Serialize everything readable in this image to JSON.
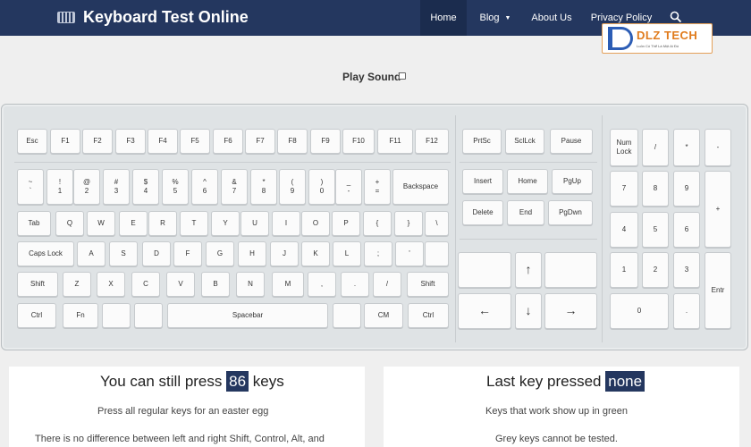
{
  "header": {
    "title": "Keyboard Test Online",
    "nav": [
      "Home",
      "Blog",
      "About Us",
      "Privacy Policy"
    ]
  },
  "logo": {
    "text": "DLZ TECH",
    "tagline": "Luôn Có Thể Là Một Ai Đó"
  },
  "sound": {
    "label": "Play Sound"
  },
  "keyboard": {
    "main": [
      {
        "l": "Esc"
      },
      {
        "l": "F1"
      },
      {
        "l": "F2"
      },
      {
        "l": "F3"
      },
      {
        "l": "F4"
      },
      {
        "l": "F5"
      },
      {
        "l": "F6"
      },
      {
        "l": "F7"
      },
      {
        "l": "F8"
      },
      {
        "l": "F9"
      },
      {
        "l": "F10"
      },
      {
        "l": "F11"
      },
      {
        "l": "F12"
      },
      {
        "t": "~",
        "b": "`"
      },
      {
        "t": "!",
        "b": "1"
      },
      {
        "t": "@",
        "b": "2"
      },
      {
        "t": "#",
        "b": "3"
      },
      {
        "t": "$",
        "b": "4"
      },
      {
        "t": "%",
        "b": "5"
      },
      {
        "t": "^",
        "b": "6"
      },
      {
        "t": "&",
        "b": "7"
      },
      {
        "t": "*",
        "b": "8"
      },
      {
        "t": "(",
        "b": "9"
      },
      {
        "t": ")",
        "b": "0"
      },
      {
        "t": "_",
        "b": "-"
      },
      {
        "t": "+",
        "b": "="
      },
      {
        "l": "Backspace"
      },
      {
        "l": "Tab"
      },
      {
        "l": "Q"
      },
      {
        "l": "W"
      },
      {
        "l": "E"
      },
      {
        "l": "R"
      },
      {
        "l": "T"
      },
      {
        "l": "Y"
      },
      {
        "l": "U"
      },
      {
        "l": "I"
      },
      {
        "l": "O"
      },
      {
        "l": "P"
      },
      {
        "l": "{"
      },
      {
        "l": "}"
      },
      {
        "l": "\\"
      },
      {
        "l": "Caps Lock"
      },
      {
        "l": "A"
      },
      {
        "l": "S"
      },
      {
        "l": "D"
      },
      {
        "l": "F"
      },
      {
        "l": "G"
      },
      {
        "l": "H"
      },
      {
        "l": "J"
      },
      {
        "l": "K"
      },
      {
        "l": "L"
      },
      {
        "l": ";"
      },
      {
        "l": "'"
      },
      {
        "l": ""
      },
      {
        "l": "Shift"
      },
      {
        "l": "Z"
      },
      {
        "l": "X"
      },
      {
        "l": "C"
      },
      {
        "l": "V"
      },
      {
        "l": "B"
      },
      {
        "l": "N"
      },
      {
        "l": "M"
      },
      {
        "l": ","
      },
      {
        "l": "."
      },
      {
        "l": "/"
      },
      {
        "l": "Shift"
      },
      {
        "l": "Ctrl"
      },
      {
        "l": "Fn"
      },
      {
        "l": ""
      },
      {
        "l": ""
      },
      {
        "l": "Spacebar"
      },
      {
        "l": ""
      },
      {
        "l": "CM"
      },
      {
        "l": "Ctrl"
      }
    ],
    "nav": [
      {
        "l": "PrtSc"
      },
      {
        "l": "SclLck"
      },
      {
        "l": "Pause"
      },
      {
        "l": "Insert"
      },
      {
        "l": "Home"
      },
      {
        "l": "PgUp"
      },
      {
        "l": "Delete"
      },
      {
        "l": "End"
      },
      {
        "l": "PgDwn"
      },
      {
        "l": ""
      },
      {
        "l": "↑"
      },
      {
        "l": ""
      },
      {
        "l": "←"
      },
      {
        "l": "↓"
      },
      {
        "l": "→"
      }
    ],
    "numpad": [
      {
        "t": "Num",
        "b": "Lock"
      },
      {
        "l": "/"
      },
      {
        "l": "*"
      },
      {
        "l": "-"
      },
      {
        "l": "7"
      },
      {
        "l": "8"
      },
      {
        "l": "9"
      },
      {
        "l": "+"
      },
      {
        "l": "4"
      },
      {
        "l": "5"
      },
      {
        "l": "6"
      },
      {
        "l": "1"
      },
      {
        "l": "2"
      },
      {
        "l": "3"
      },
      {
        "l": "Entr"
      },
      {
        "l": "0"
      },
      {
        "l": "."
      }
    ]
  },
  "left_panel": {
    "title_before": "You can still press",
    "count": "86",
    "title_after": "keys",
    "line1": "Press all regular keys for an easter egg",
    "line2": "There is no difference between left and right Shift, Control, Alt, and"
  },
  "right_panel": {
    "title_before": "Last key pressed",
    "value": "none",
    "line1": "Keys that work show up in green",
    "line2": "Grey keys cannot be tested."
  },
  "colors": {
    "header": "#24375f",
    "accent": "#e07b1c"
  }
}
